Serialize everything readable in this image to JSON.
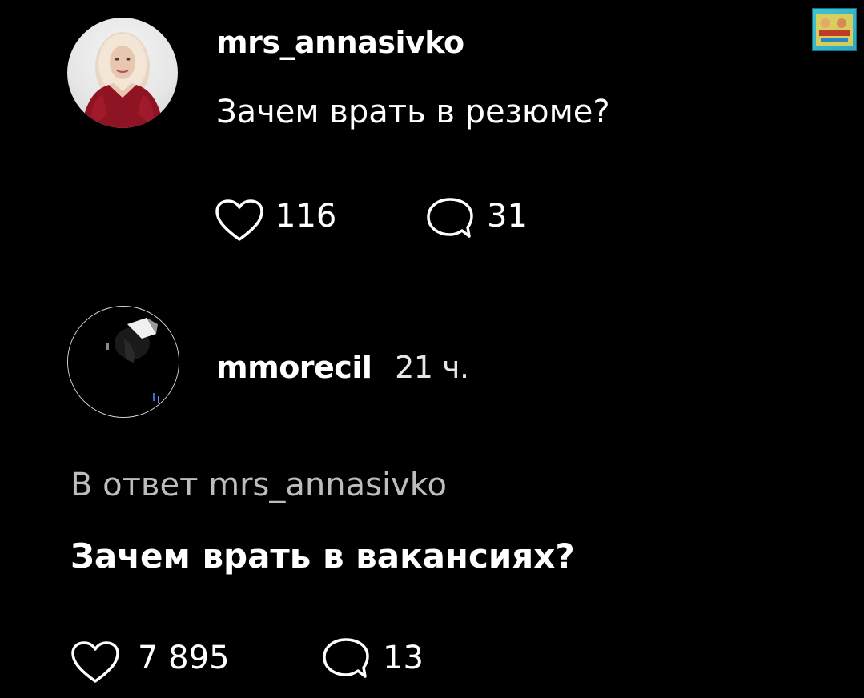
{
  "post": {
    "username": "mrs_annasivko",
    "text": "Зачем врать в резюме?",
    "likes": "116",
    "comments": "31"
  },
  "reply": {
    "username": "mmorecil",
    "time": "21 ч.",
    "reply_to": "В ответ mrs_annasivko",
    "text": "Зачем врать в вакансиях?",
    "likes": "7 895",
    "comments": "13"
  },
  "icons": {
    "like": "heart-icon",
    "comment": "comment-bubble-icon"
  },
  "colors": {
    "background": "#000000",
    "text": "#ffffff",
    "muted": "#bdbdbd"
  }
}
